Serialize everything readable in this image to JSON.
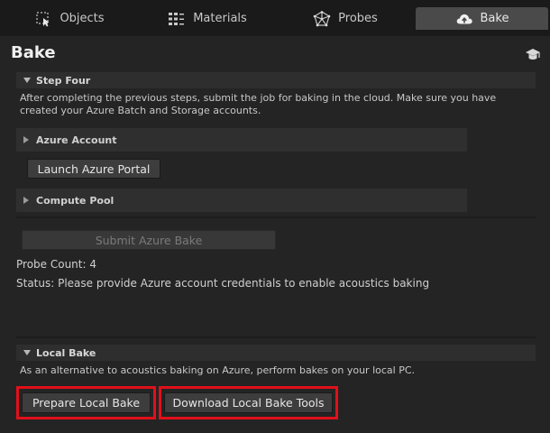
{
  "tabs": [
    {
      "label": "Objects",
      "icon": "objects-icon",
      "active": false
    },
    {
      "label": "Materials",
      "icon": "materials-icon",
      "active": false
    },
    {
      "label": "Probes",
      "icon": "probes-icon",
      "active": false
    },
    {
      "label": "Bake",
      "icon": "cloud-upload-icon",
      "active": true
    }
  ],
  "panel": {
    "title": "Bake",
    "step_four": {
      "header": "Step Four",
      "description": "After completing the previous steps, submit the job for baking in the cloud. Make sure you have created your Azure Batch and Storage accounts.",
      "azure_account_label": "Azure Account",
      "launch_portal_label": "Launch Azure Portal",
      "compute_pool_label": "Compute Pool",
      "submit_label": "Submit Azure Bake",
      "probe_count": "Probe Count: 4",
      "status": "Status: Please provide Azure account credentials to enable acoustics baking"
    },
    "local_bake": {
      "header": "Local Bake",
      "description": "As an alternative to acoustics baking on Azure, perform bakes on your local PC.",
      "prepare_label": "Prepare Local Bake",
      "download_label": "Download Local Bake Tools"
    }
  },
  "colors": {
    "highlight": "#e0101a",
    "background": "#242424",
    "tab_active": "#4a4a4a"
  }
}
